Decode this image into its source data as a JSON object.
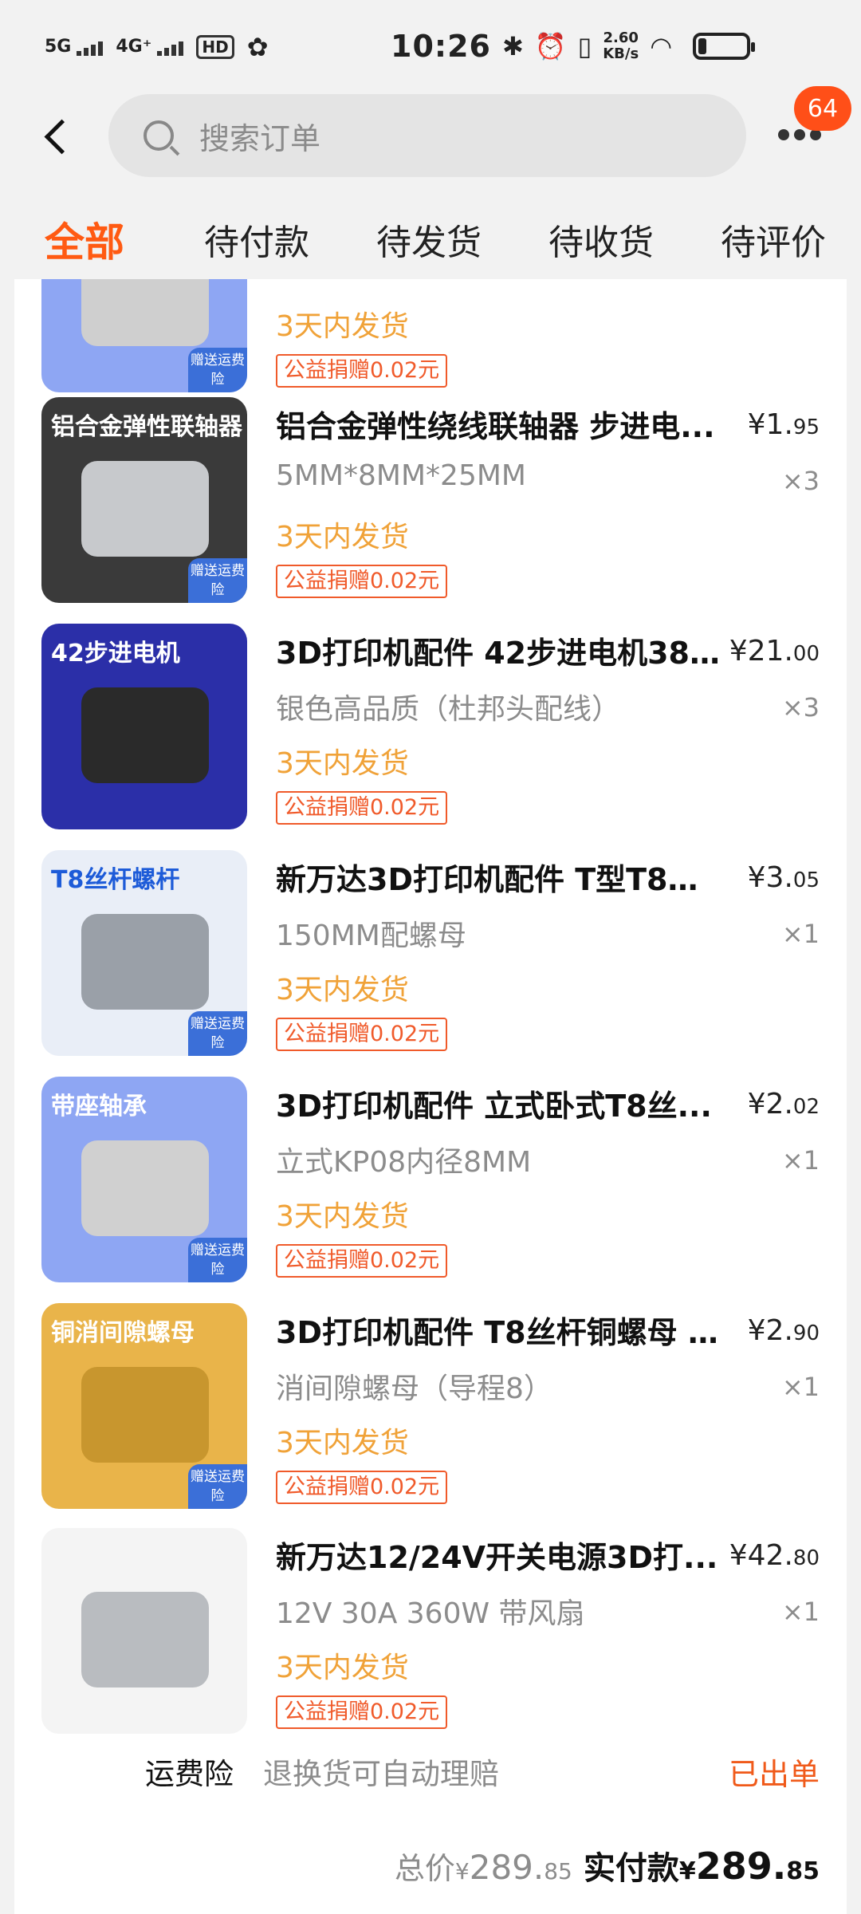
{
  "status_bar": {
    "net1": "5G",
    "net2": "4G⁺",
    "hd": "HD",
    "time": "10:26",
    "speed_value": "2.60",
    "speed_unit": "KB/s"
  },
  "header": {
    "search_placeholder": "搜索订单",
    "badge": "64"
  },
  "tabs": [
    "全部",
    "待付款",
    "待发货",
    "待收货",
    "待评价"
  ],
  "items": [
    {
      "thumb_label": "",
      "thumb_tag": "赠送运费险",
      "thumb_bg": "#8ea6f3",
      "title": "",
      "price_int": "",
      "price_dec": "",
      "spec": "",
      "qty": "",
      "ship": "3天内发货",
      "donate": "公益捐赠0.02元"
    },
    {
      "thumb_label": "铝合金弹性联轴器",
      "thumb_tag": "赠送运费险",
      "thumb_bg": "#3a3a3a",
      "title": "铝合金弹性绕线联轴器 步进电...",
      "price_int": "¥1.",
      "price_dec": "95",
      "spec": "5MM*8MM*25MM",
      "qty": "×3",
      "ship": "3天内发货",
      "donate": "公益捐赠0.02元"
    },
    {
      "thumb_label": "42步进电机",
      "thumb_tag": "",
      "thumb_bg": "#2b2fa8",
      "title": "3D打印机配件 42步进电机38...",
      "price_int": "¥21.",
      "price_dec": "00",
      "spec": "银色高品质（杜邦头配线）",
      "qty": "×3",
      "ship": "3天内发货",
      "donate": "公益捐赠0.02元"
    },
    {
      "thumb_label": "T8丝杆螺杆",
      "thumb_tag": "赠送运费险",
      "thumb_bg": "#e9eef7",
      "title": "新万达3D打印机配件 T型T8不...",
      "price_int": "¥3.",
      "price_dec": "05",
      "spec": "150MM配螺母",
      "qty": "×1",
      "ship": "3天内发货",
      "donate": "公益捐赠0.02元"
    },
    {
      "thumb_label": "带座轴承",
      "thumb_tag": "赠送运费险",
      "thumb_bg": "#8ea6f3",
      "title": "3D打印机配件 立式卧式T8丝...",
      "price_int": "¥2.",
      "price_dec": "02",
      "spec": "立式KP08内径8MM",
      "qty": "×1",
      "ship": "3天内发货",
      "donate": "公益捐赠0.02元"
    },
    {
      "thumb_label": "铜消间隙螺母",
      "thumb_tag": "赠送运费险",
      "thumb_bg": "#e9b44a",
      "title": "3D打印机配件 T8丝杆铜螺母 ...",
      "price_int": "¥2.",
      "price_dec": "90",
      "spec": "消间隙螺母（导程8）",
      "qty": "×1",
      "ship": "3天内发货",
      "donate": "公益捐赠0.02元"
    },
    {
      "thumb_label": "",
      "thumb_tag": "",
      "thumb_bg": "#f4f4f4",
      "title": "新万达12/24V开关电源3D打...",
      "price_int": "¥42.",
      "price_dec": "80",
      "spec": "12V 30A 360W 带风扇",
      "qty": "×1",
      "ship": "3天内发货",
      "donate": "公益捐赠0.02元"
    }
  ],
  "insurance": {
    "label": "运费险",
    "desc": "退换货可自动理赔",
    "status": "已出单"
  },
  "total": {
    "label": "总价",
    "cur": "¥",
    "int": "289.",
    "dec": "85",
    "paid_label": "实付款",
    "paid_cur": "¥",
    "paid_int": "289.",
    "paid_dec": "85"
  },
  "colors": {
    "accent": "#ff5a12",
    "ship": "#f0a238",
    "donate": "#f05a2a"
  }
}
